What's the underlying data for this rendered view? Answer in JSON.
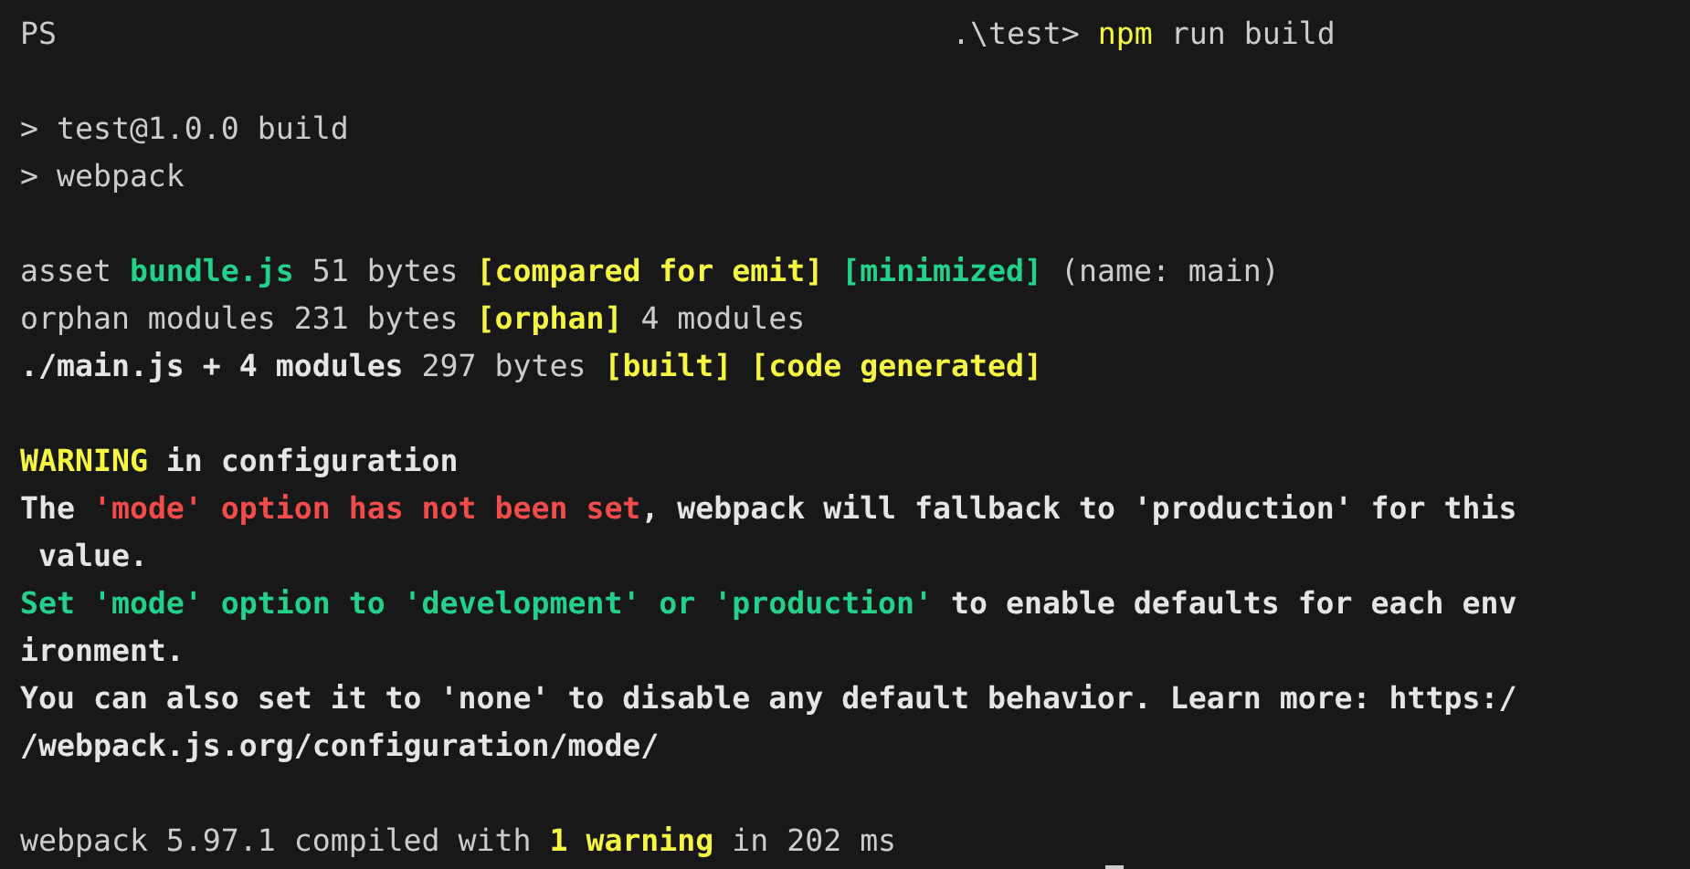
{
  "terminal": {
    "prompt": {
      "shell": "PS",
      "path": ".\\test>",
      "command": "npm",
      "arguments": "run build"
    },
    "lines": [
      {
        "kind": "blank"
      },
      {
        "kind": "text",
        "segments": [
          {
            "text": "> test@1.0.0 build",
            "color": "#cccccc",
            "bold": false
          }
        ]
      },
      {
        "kind": "text",
        "segments": [
          {
            "text": "> webpack",
            "color": "#cccccc",
            "bold": false
          }
        ]
      },
      {
        "kind": "blank"
      },
      {
        "kind": "text",
        "segments": [
          {
            "text": "asset ",
            "color": "#cccccc",
            "bold": false
          },
          {
            "text": "bundle.js",
            "color": "#23d18b",
            "bold": true
          },
          {
            "text": " 51 bytes ",
            "color": "#cccccc",
            "bold": false
          },
          {
            "text": "[compared for emit]",
            "color": "#f5f543",
            "bold": true
          },
          {
            "text": " [minimized]",
            "color": "#23d18b",
            "bold": true
          },
          {
            "text": " (name: main)",
            "color": "#cccccc",
            "bold": false
          }
        ]
      },
      {
        "kind": "text",
        "segments": [
          {
            "text": "orphan modules 231 bytes ",
            "color": "#cccccc",
            "bold": false
          },
          {
            "text": "[orphan]",
            "color": "#f5f543",
            "bold": true
          },
          {
            "text": " 4 modules",
            "color": "#cccccc",
            "bold": false
          }
        ]
      },
      {
        "kind": "text",
        "segments": [
          {
            "text": "./main.js + 4 modules",
            "color": "#e5e5e5",
            "bold": true
          },
          {
            "text": " 297 bytes ",
            "color": "#cccccc",
            "bold": false
          },
          {
            "text": "[built]",
            "color": "#f5f543",
            "bold": true
          },
          {
            "text": " [code generated]",
            "color": "#f5f543",
            "bold": true
          }
        ]
      },
      {
        "kind": "blank"
      },
      {
        "kind": "text",
        "segments": [
          {
            "text": "WARNING",
            "color": "#f5f543",
            "bold": true
          },
          {
            "text": " in configuration",
            "color": "#e5e5e5",
            "bold": true
          }
        ]
      },
      {
        "kind": "text",
        "segments": [
          {
            "text": "The ",
            "color": "#e5e5e5",
            "bold": true
          },
          {
            "text": "'mode' option has not been set",
            "color": "#f14c4c",
            "bold": true
          },
          {
            "text": ", webpack will fallback to 'production' for this",
            "color": "#e5e5e5",
            "bold": true
          }
        ]
      },
      {
        "kind": "text",
        "segments": [
          {
            "text": " value.",
            "color": "#e5e5e5",
            "bold": true
          }
        ]
      },
      {
        "kind": "text",
        "segments": [
          {
            "text": "Set 'mode' option to 'development' or 'production'",
            "color": "#23d18b",
            "bold": true
          },
          {
            "text": " to enable defaults for each env",
            "color": "#e5e5e5",
            "bold": true
          }
        ]
      },
      {
        "kind": "text",
        "segments": [
          {
            "text": "ironment.",
            "color": "#e5e5e5",
            "bold": true
          }
        ]
      },
      {
        "kind": "text",
        "segments": [
          {
            "text": "You can also set it to 'none' to disable any default behavior. Learn more: https:/",
            "color": "#e5e5e5",
            "bold": true
          }
        ]
      },
      {
        "kind": "text",
        "segments": [
          {
            "text": "/webpack.js.org/configuration/mode/",
            "color": "#e5e5e5",
            "bold": true
          }
        ]
      },
      {
        "kind": "blank"
      },
      {
        "kind": "text",
        "segments": [
          {
            "text": "webpack 5.97.1 compiled with ",
            "color": "#cccccc",
            "bold": false
          },
          {
            "text": "1 warning",
            "color": "#f5f543",
            "bold": true
          },
          {
            "text": " in 202 ms",
            "color": "#cccccc",
            "bold": false
          }
        ]
      },
      {
        "kind": "cursor"
      }
    ]
  }
}
